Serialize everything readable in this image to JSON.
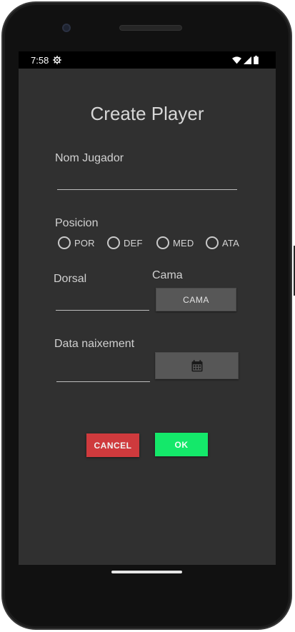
{
  "status_bar": {
    "time": "7:58",
    "settings_icon": "gear-icon",
    "wifi_icon": "wifi-icon",
    "signal_icon": "signal-icon",
    "battery_icon": "battery-icon"
  },
  "form": {
    "title": "Create Player",
    "name_label": "Nom Jugador",
    "name_value": "",
    "position_label": "Posicion",
    "position_options": [
      "POR",
      "DEF",
      "MED",
      "ATA"
    ],
    "dorsal_label": "Dorsal",
    "dorsal_value": "",
    "cama_label": "Cama",
    "cama_button": "CAMA",
    "birth_label": "Data naixement",
    "birth_value": "",
    "calendar_icon": "calendar-icon"
  },
  "actions": {
    "cancel": "CANCEL",
    "ok": "OK"
  },
  "colors": {
    "screen_bg": "#303030",
    "cancel_bg": "#cf3a3d",
    "ok_bg": "#14e86a",
    "button_gray": "#575757"
  }
}
